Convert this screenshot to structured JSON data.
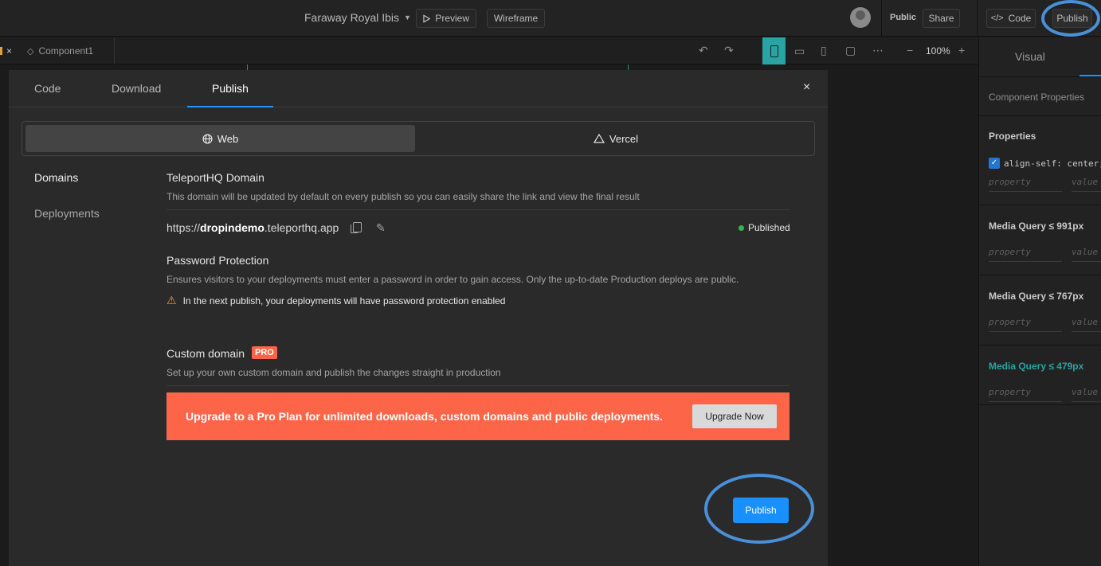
{
  "topbar": {
    "project_name": "Faraway Royal Ibis",
    "preview_label": "Preview",
    "wireframe_label": "Wireframe",
    "public_label": "Public",
    "share_label": "Share",
    "code_label": "Code",
    "publish_label": "Publish"
  },
  "subbar": {
    "close_glyph": "×",
    "component_tab": "Component1",
    "zoom": "100%"
  },
  "right_panel": {
    "tab_visual": "Visual",
    "component_properties": "Component Properties",
    "properties_heading": "Properties",
    "property_code": "align-self: center;",
    "property_placeholder": "property",
    "value_placeholder": "value",
    "mq_991": "Media Query ≤ 991px",
    "mq_767": "Media Query ≤ 767px",
    "mq_479": "Media Query ≤ 479px"
  },
  "modal": {
    "tabs": [
      {
        "label": "Code"
      },
      {
        "label": "Download"
      },
      {
        "label": "Publish"
      }
    ],
    "close_glyph": "×",
    "segments": {
      "web": "Web",
      "vercel": "Vercel"
    },
    "sidebar": {
      "domains": "Domains",
      "deployments": "Deployments"
    },
    "teleport_domain": {
      "title": "TeleportHQ Domain",
      "desc": "This domain will be updated by default on every publish so you can easily share the link and view the final result",
      "url_prefix": "https://",
      "url_name": "dropindemo",
      "url_suffix": ".teleporthq.app",
      "status": "Published",
      "status_color": "#2fb84f"
    },
    "password": {
      "title": "Password Protection",
      "desc": "Ensures visitors to your deployments must enter a password in order to gain access. Only the up-to-date Production deploys are public.",
      "warning": "In the next publish, your deployments will have password protection enabled"
    },
    "custom_domain": {
      "title": "Custom domain",
      "badge": "PRO",
      "desc": "Set up your own custom domain and publish the changes straight in production"
    },
    "upgrade": {
      "text": "Upgrade to a Pro Plan for unlimited downloads, custom domains and public deployments.",
      "button": "Upgrade Now",
      "color": "#fc6548"
    },
    "publish_button": "Publish",
    "accent": "#1890ff"
  }
}
